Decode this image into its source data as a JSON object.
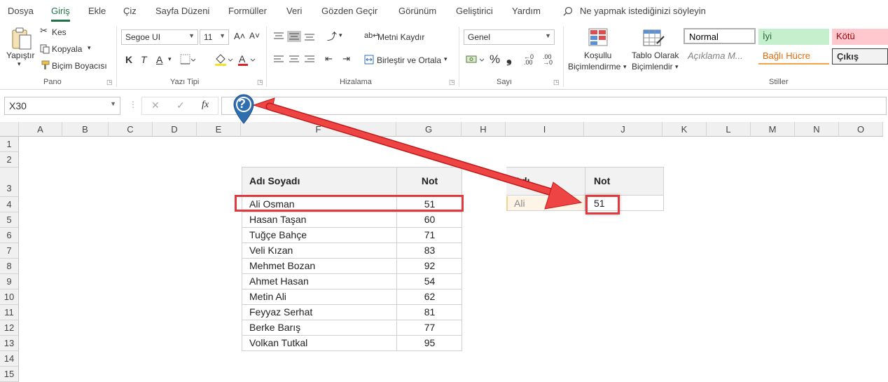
{
  "menu": {
    "tabs": [
      "Dosya",
      "Giriş",
      "Ekle",
      "Çiz",
      "Sayfa Düzeni",
      "Formüller",
      "Veri",
      "Gözden Geçir",
      "Görünüm",
      "Geliştirici",
      "Yardım"
    ],
    "search": "Ne yapmak istediğinizi söyleyin"
  },
  "ribbon": {
    "pano": {
      "paste": "Yapıştır",
      "cut": "Kes",
      "copy": "Kopyala",
      "format_painter": "Biçim Boyacısı",
      "label": "Pano"
    },
    "font": {
      "name": "Segoe UI",
      "size": "11",
      "grow": "A˄",
      "shrink": "A˅",
      "bold": "K",
      "italic": "T",
      "underline": "A",
      "label": "Yazı Tipi"
    },
    "align": {
      "wrap": "Metni Kaydır",
      "merge": "Birleştir ve Ortala",
      "label": "Hizalama"
    },
    "number": {
      "format": "Genel",
      "percent": "%",
      "comma": "❟",
      "label": "Sayı"
    },
    "styles": {
      "conditional": [
        "Koşullu",
        "Biçimlendirme"
      ],
      "table": [
        "Tablo Olarak",
        "Biçimlendir"
      ],
      "normal": "Normal",
      "good": "İyi",
      "bad": "Kötü",
      "explanatory": "Açıklama M...",
      "linked": "Bağlı Hücre",
      "output": "Çıkış",
      "label": "Stiller"
    }
  },
  "formula_bar": {
    "name_box": "X30",
    "fx": "fx",
    "cancel": "✕",
    "enter": "✓"
  },
  "columns": [
    "A",
    "B",
    "C",
    "D",
    "E",
    "F",
    "G",
    "H",
    "I",
    "J",
    "K",
    "L",
    "M",
    "N",
    "O"
  ],
  "rows": [
    "1",
    "2",
    "3",
    "4",
    "5",
    "6",
    "7",
    "8",
    "9",
    "10",
    "11",
    "12",
    "13",
    "14",
    "15"
  ],
  "table1": {
    "header_name": "Adı Soyadı",
    "header_score": "Not",
    "rows": [
      {
        "name": "Ali Osman",
        "score": "51"
      },
      {
        "name": "Hasan Taşan",
        "score": "60"
      },
      {
        "name": "Tuğçe Bahçe",
        "score": "71"
      },
      {
        "name": "Veli Kızan",
        "score": "83"
      },
      {
        "name": "Mehmet Bozan",
        "score": "92"
      },
      {
        "name": "Ahmet Hasan",
        "score": "54"
      },
      {
        "name": "Metin Ali",
        "score": "62"
      },
      {
        "name": "Feyyaz Serhat",
        "score": "81"
      },
      {
        "name": "Berke Barış",
        "score": "77"
      },
      {
        "name": "Volkan Tutkal",
        "score": "95"
      }
    ]
  },
  "table2": {
    "header_name": "Adı",
    "header_score": "Not",
    "name": "Ali",
    "score": "51"
  },
  "help_badge": "?",
  "colors": {
    "accent": "#217346",
    "highlight": "#e0393e",
    "arrow": "#ef4444",
    "marker": "#2f6fb0"
  }
}
